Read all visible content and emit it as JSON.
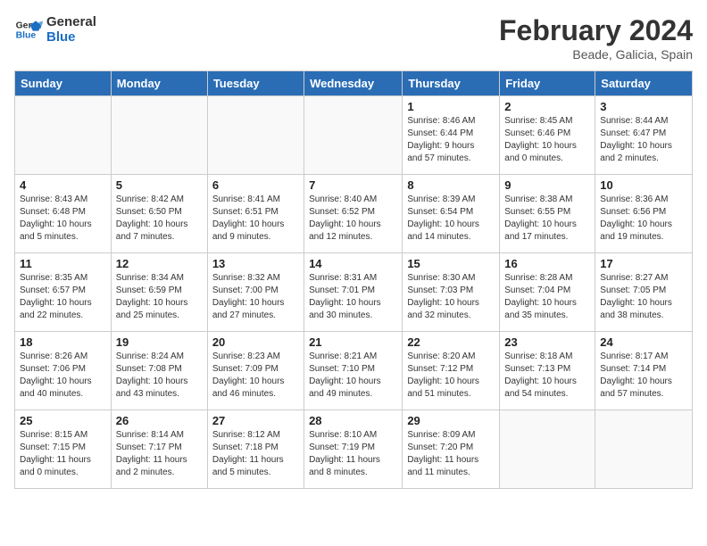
{
  "header": {
    "logo_general": "General",
    "logo_blue": "Blue",
    "month_year": "February 2024",
    "location": "Beade, Galicia, Spain"
  },
  "days_of_week": [
    "Sunday",
    "Monday",
    "Tuesday",
    "Wednesday",
    "Thursday",
    "Friday",
    "Saturday"
  ],
  "weeks": [
    [
      {
        "day": "",
        "info": ""
      },
      {
        "day": "",
        "info": ""
      },
      {
        "day": "",
        "info": ""
      },
      {
        "day": "",
        "info": ""
      },
      {
        "day": "1",
        "info": "Sunrise: 8:46 AM\nSunset: 6:44 PM\nDaylight: 9 hours\nand 57 minutes."
      },
      {
        "day": "2",
        "info": "Sunrise: 8:45 AM\nSunset: 6:46 PM\nDaylight: 10 hours\nand 0 minutes."
      },
      {
        "day": "3",
        "info": "Sunrise: 8:44 AM\nSunset: 6:47 PM\nDaylight: 10 hours\nand 2 minutes."
      }
    ],
    [
      {
        "day": "4",
        "info": "Sunrise: 8:43 AM\nSunset: 6:48 PM\nDaylight: 10 hours\nand 5 minutes."
      },
      {
        "day": "5",
        "info": "Sunrise: 8:42 AM\nSunset: 6:50 PM\nDaylight: 10 hours\nand 7 minutes."
      },
      {
        "day": "6",
        "info": "Sunrise: 8:41 AM\nSunset: 6:51 PM\nDaylight: 10 hours\nand 9 minutes."
      },
      {
        "day": "7",
        "info": "Sunrise: 8:40 AM\nSunset: 6:52 PM\nDaylight: 10 hours\nand 12 minutes."
      },
      {
        "day": "8",
        "info": "Sunrise: 8:39 AM\nSunset: 6:54 PM\nDaylight: 10 hours\nand 14 minutes."
      },
      {
        "day": "9",
        "info": "Sunrise: 8:38 AM\nSunset: 6:55 PM\nDaylight: 10 hours\nand 17 minutes."
      },
      {
        "day": "10",
        "info": "Sunrise: 8:36 AM\nSunset: 6:56 PM\nDaylight: 10 hours\nand 19 minutes."
      }
    ],
    [
      {
        "day": "11",
        "info": "Sunrise: 8:35 AM\nSunset: 6:57 PM\nDaylight: 10 hours\nand 22 minutes."
      },
      {
        "day": "12",
        "info": "Sunrise: 8:34 AM\nSunset: 6:59 PM\nDaylight: 10 hours\nand 25 minutes."
      },
      {
        "day": "13",
        "info": "Sunrise: 8:32 AM\nSunset: 7:00 PM\nDaylight: 10 hours\nand 27 minutes."
      },
      {
        "day": "14",
        "info": "Sunrise: 8:31 AM\nSunset: 7:01 PM\nDaylight: 10 hours\nand 30 minutes."
      },
      {
        "day": "15",
        "info": "Sunrise: 8:30 AM\nSunset: 7:03 PM\nDaylight: 10 hours\nand 32 minutes."
      },
      {
        "day": "16",
        "info": "Sunrise: 8:28 AM\nSunset: 7:04 PM\nDaylight: 10 hours\nand 35 minutes."
      },
      {
        "day": "17",
        "info": "Sunrise: 8:27 AM\nSunset: 7:05 PM\nDaylight: 10 hours\nand 38 minutes."
      }
    ],
    [
      {
        "day": "18",
        "info": "Sunrise: 8:26 AM\nSunset: 7:06 PM\nDaylight: 10 hours\nand 40 minutes."
      },
      {
        "day": "19",
        "info": "Sunrise: 8:24 AM\nSunset: 7:08 PM\nDaylight: 10 hours\nand 43 minutes."
      },
      {
        "day": "20",
        "info": "Sunrise: 8:23 AM\nSunset: 7:09 PM\nDaylight: 10 hours\nand 46 minutes."
      },
      {
        "day": "21",
        "info": "Sunrise: 8:21 AM\nSunset: 7:10 PM\nDaylight: 10 hours\nand 49 minutes."
      },
      {
        "day": "22",
        "info": "Sunrise: 8:20 AM\nSunset: 7:12 PM\nDaylight: 10 hours\nand 51 minutes."
      },
      {
        "day": "23",
        "info": "Sunrise: 8:18 AM\nSunset: 7:13 PM\nDaylight: 10 hours\nand 54 minutes."
      },
      {
        "day": "24",
        "info": "Sunrise: 8:17 AM\nSunset: 7:14 PM\nDaylight: 10 hours\nand 57 minutes."
      }
    ],
    [
      {
        "day": "25",
        "info": "Sunrise: 8:15 AM\nSunset: 7:15 PM\nDaylight: 11 hours\nand 0 minutes."
      },
      {
        "day": "26",
        "info": "Sunrise: 8:14 AM\nSunset: 7:17 PM\nDaylight: 11 hours\nand 2 minutes."
      },
      {
        "day": "27",
        "info": "Sunrise: 8:12 AM\nSunset: 7:18 PM\nDaylight: 11 hours\nand 5 minutes."
      },
      {
        "day": "28",
        "info": "Sunrise: 8:10 AM\nSunset: 7:19 PM\nDaylight: 11 hours\nand 8 minutes."
      },
      {
        "day": "29",
        "info": "Sunrise: 8:09 AM\nSunset: 7:20 PM\nDaylight: 11 hours\nand 11 minutes."
      },
      {
        "day": "",
        "info": ""
      },
      {
        "day": "",
        "info": ""
      }
    ]
  ]
}
